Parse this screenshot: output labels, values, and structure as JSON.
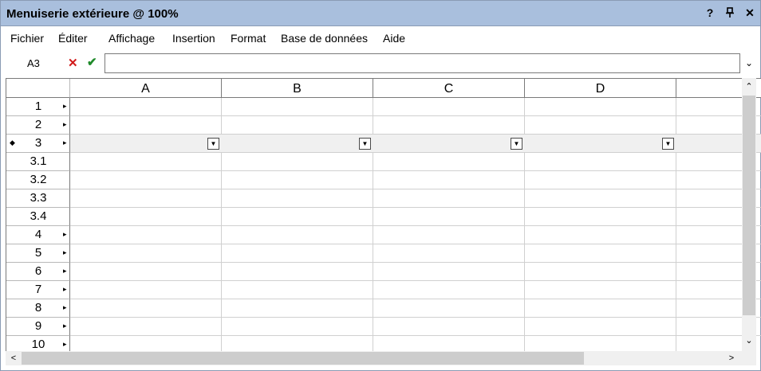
{
  "window": {
    "title": "Menuiserie extérieure @ 100%",
    "help_glyph": "?",
    "pin_glyph": "⊥",
    "close_glyph": "✕"
  },
  "menu": {
    "items": [
      "Fichier",
      "Éditer",
      "Affichage",
      "Insertion",
      "Format",
      "Base de données",
      "Aide"
    ]
  },
  "formula_bar": {
    "cell_ref": "A3",
    "cancel_glyph": "✕",
    "confirm_glyph": "✔",
    "value": "",
    "dropdown_glyph": "⌄"
  },
  "grid": {
    "columns": [
      "A",
      "B",
      "C",
      "D"
    ],
    "rows": [
      {
        "label": "1",
        "expandable": true,
        "selected": false
      },
      {
        "label": "2",
        "expandable": true,
        "selected": false
      },
      {
        "label": "3",
        "expandable": true,
        "selected": true
      },
      {
        "label": "3.1",
        "expandable": false,
        "selected": false
      },
      {
        "label": "3.2",
        "expandable": false,
        "selected": false
      },
      {
        "label": "3.3",
        "expandable": false,
        "selected": false
      },
      {
        "label": "3.4",
        "expandable": false,
        "selected": false
      },
      {
        "label": "4",
        "expandable": true,
        "selected": false
      },
      {
        "label": "5",
        "expandable": true,
        "selected": false
      },
      {
        "label": "6",
        "expandable": true,
        "selected": false
      },
      {
        "label": "7",
        "expandable": true,
        "selected": false
      },
      {
        "label": "8",
        "expandable": true,
        "selected": false
      },
      {
        "label": "9",
        "expandable": true,
        "selected": false
      },
      {
        "label": "10",
        "expandable": true,
        "selected": false
      }
    ],
    "expand_glyph": "▸",
    "selected_marker_glyph": "◆",
    "cell_dropdown_glyph": "▼"
  },
  "scrollbars": {
    "up_glyph": "⌃",
    "down_glyph": "⌄",
    "left_glyph": "<",
    "right_glyph": ">"
  },
  "colors": {
    "titlebar": "#a9bfdd",
    "cancel": "#d11a1a",
    "confirm": "#1f8a2a",
    "selected_row": "#f0f0f0"
  }
}
